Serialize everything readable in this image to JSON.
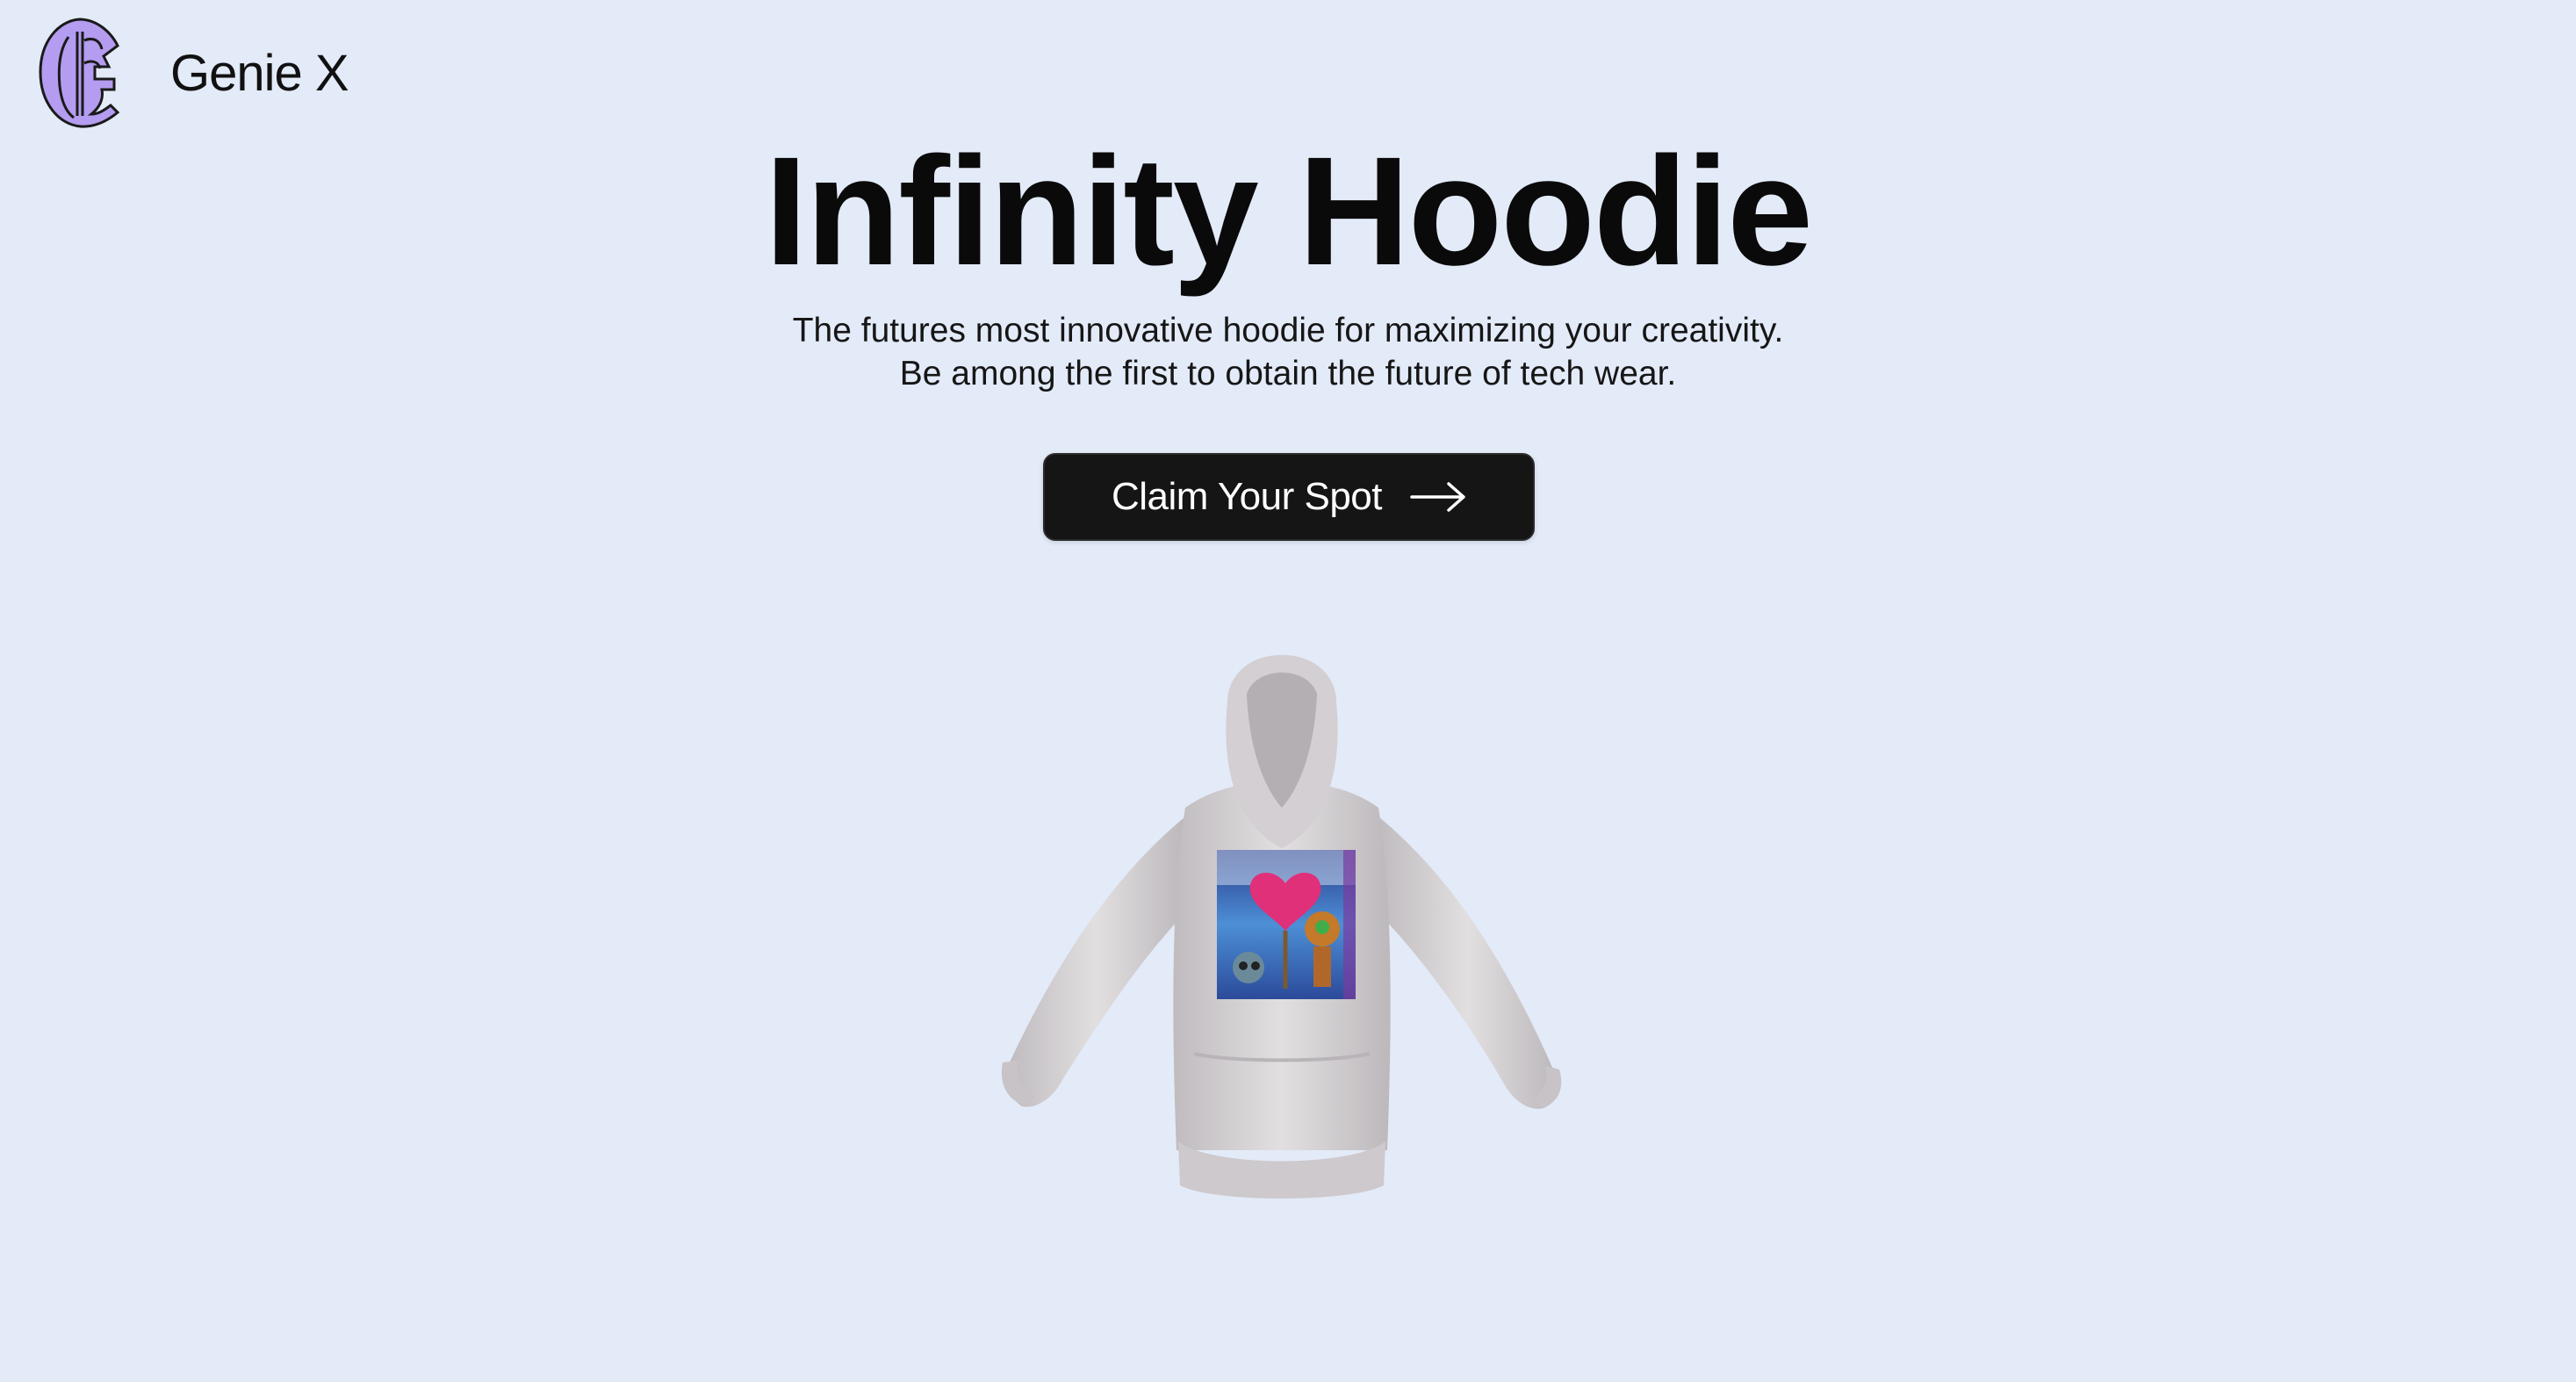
{
  "header": {
    "brand_name": "Genie X",
    "logo_icon": "genie-x-logo-icon"
  },
  "hero": {
    "title": "Infinity Hoodie",
    "subtitle_lines": [
      "The futures most innovative hoodie for maximizing your creativity.",
      "Be among the first to obtain the future of tech wear."
    ]
  },
  "cta": {
    "label": "Claim Your Spot",
    "icon": "arrow-right-icon"
  },
  "product": {
    "image_icon": "hoodie-3d-model",
    "print_icon": "robot-heart-print"
  },
  "colors": {
    "background": "#e3eaf8",
    "button_bg": "#151515",
    "button_text": "#ffffff",
    "logo_fill": "#b49cf0",
    "hoodie": "#d8d4d6"
  }
}
